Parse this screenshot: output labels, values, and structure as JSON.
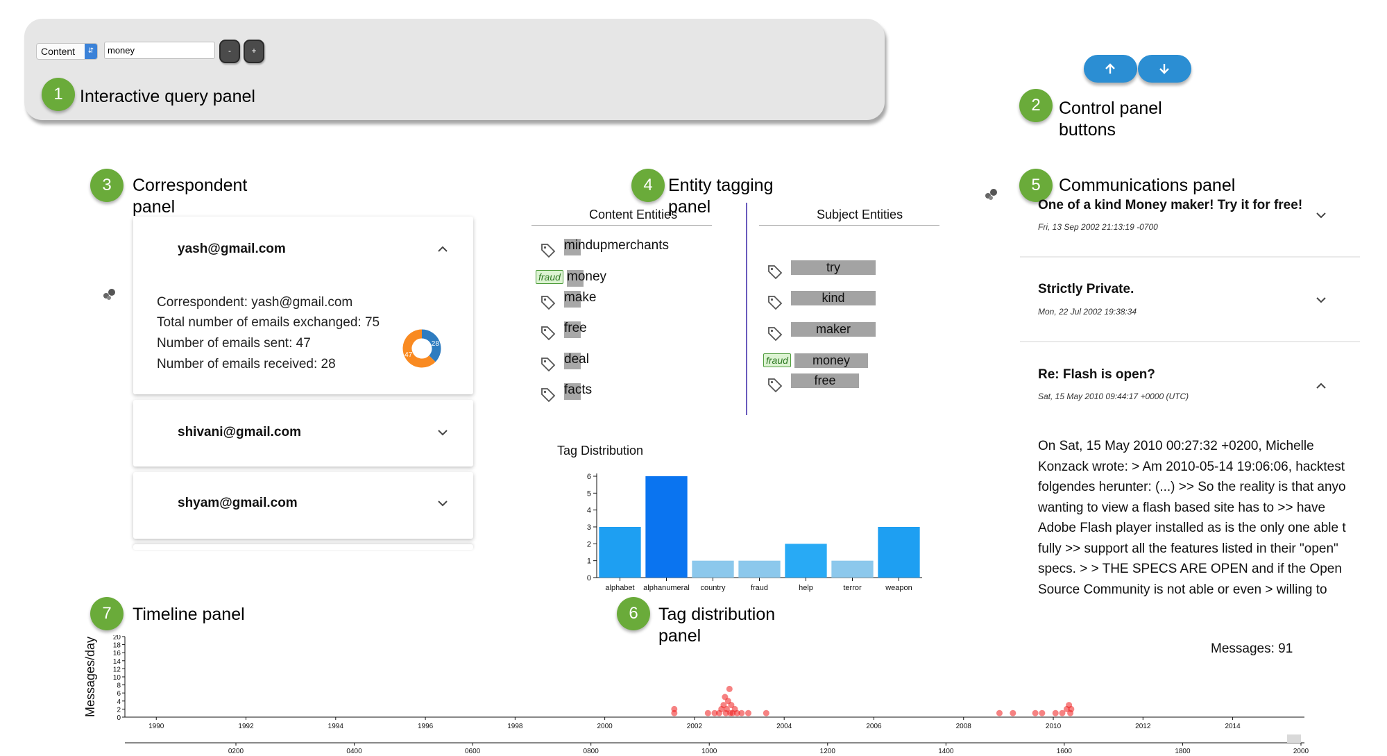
{
  "query": {
    "mode": "Content",
    "value": "money",
    "minus": "-",
    "plus": "+"
  },
  "annotations": [
    {
      "num": "1",
      "label": "Interactive query panel"
    },
    {
      "num": "2",
      "label": "Control panel\nbuttons"
    },
    {
      "num": "3",
      "label": "Correspondent\npanel"
    },
    {
      "num": "4",
      "label": "Entity tagging\npanel"
    },
    {
      "num": "5",
      "label": "Communications panel"
    },
    {
      "num": "6",
      "label": "Tag distribution\npanel"
    },
    {
      "num": "7",
      "label": "Timeline panel"
    }
  ],
  "correspondents": [
    {
      "email": "yash@gmail.com",
      "expanded": true,
      "details": {
        "correspondent": "Correspondent:  yash@gmail.com",
        "total": "Total number of emails exchanged:   75",
        "sent": "Number of emails sent:  47",
        "received": "Number of emails received:   28"
      },
      "donut": {
        "sent": 47,
        "received": 28,
        "sent_color": "#f98a21",
        "received_color": "#2e7cc0"
      }
    },
    {
      "email": "shivani@gmail.com",
      "expanded": false
    },
    {
      "email": "shyam@gmail.com",
      "expanded": false
    }
  ],
  "entities": {
    "content_header": "Content Entities",
    "subject_header": "Subject Entities",
    "fraud_label": "fraud",
    "content": [
      "mindupmerchants",
      "money",
      "make",
      "free",
      "deal",
      "facts"
    ],
    "subject": [
      "try",
      "kind",
      "maker",
      "money",
      "free"
    ]
  },
  "communications": {
    "messages": [
      {
        "subject": "One of a kind Money maker! Try it for free!",
        "date": "Fri, 13 Sep 2002 21:13:19 -0700",
        "expanded": false
      },
      {
        "subject": "Strictly Private.",
        "date": "Mon, 22 Jul 2002 19:38:34",
        "expanded": false
      },
      {
        "subject": "Re: Flash is open?",
        "date": "Sat, 15 May 2010 09:44:17 +0000 (UTC)",
        "expanded": true
      }
    ],
    "body_lines": [
      "On Sat, 15 May 2010 00:27:32 +0200, Michelle",
      "Konzack wrote: > Am 2010-05-14 19:06:06, hacktest",
      "folgendes herunter: (...) >> So the reality is that anyo",
      "wanting to view a flash based site has to >> have",
      "Adobe Flash player installed as is the only one able t",
      "fully >> support all the features listed in their \"open\"",
      "specs. > > THE SPECS ARE OPEN and if the Open",
      "Source Community is not able or even > willing to"
    ]
  },
  "chart_data": [
    {
      "type": "bar",
      "title": "Tag Distribution",
      "categories": [
        "alphabet",
        "alphanumeral",
        "country",
        "fraud",
        "help",
        "terror",
        "weapon"
      ],
      "values": [
        3,
        6,
        1,
        1,
        2,
        1,
        3
      ],
      "ylim": [
        0,
        6
      ],
      "yticks": [
        0,
        1,
        2,
        3,
        4,
        5,
        6
      ],
      "colors": [
        "#1e9ff2",
        "#0a74f0",
        "#8cc8ec",
        "#8cc8ec",
        "#28aaf5",
        "#8cc8ec",
        "#1e9ff2"
      ]
    },
    {
      "type": "scatter",
      "ylabel": "Messages/day",
      "ylim": [
        0,
        20
      ],
      "yticks": [
        0,
        2,
        4,
        6,
        8,
        10,
        12,
        14,
        16,
        18,
        20
      ],
      "xlim": [
        1989.3,
        2015.6
      ],
      "xticks": [
        "1990",
        "1992",
        "1994",
        "1996",
        "1998",
        "2000",
        "2002",
        "2004",
        "2006",
        "2008",
        "2010",
        "2012",
        "2014"
      ],
      "overview_ticks": [
        "0200",
        "0400",
        "0600",
        "0800",
        "1000",
        "1200",
        "1400",
        "1600",
        "1800",
        "2000"
      ],
      "color": "#ee1c1c",
      "points": [
        [
          2001.55,
          2
        ],
        [
          2001.55,
          1
        ],
        [
          2002.3,
          1
        ],
        [
          2002.45,
          1
        ],
        [
          2002.55,
          1
        ],
        [
          2002.6,
          2
        ],
        [
          2002.65,
          3
        ],
        [
          2002.68,
          5
        ],
        [
          2002.7,
          1
        ],
        [
          2002.72,
          2
        ],
        [
          2002.75,
          4
        ],
        [
          2002.78,
          7
        ],
        [
          2002.8,
          1
        ],
        [
          2002.82,
          3
        ],
        [
          2002.85,
          1
        ],
        [
          2002.9,
          2
        ],
        [
          2002.95,
          1
        ],
        [
          2003.05,
          1
        ],
        [
          2003.2,
          1
        ],
        [
          2003.6,
          1
        ],
        [
          2008.8,
          1
        ],
        [
          2009.1,
          1
        ],
        [
          2009.6,
          1
        ],
        [
          2009.75,
          1
        ],
        [
          2010.05,
          1
        ],
        [
          2010.2,
          1
        ],
        [
          2010.3,
          2
        ],
        [
          2010.35,
          3
        ],
        [
          2010.38,
          1
        ],
        [
          2010.4,
          2
        ]
      ],
      "messages_label": "Messages: 91"
    }
  ]
}
